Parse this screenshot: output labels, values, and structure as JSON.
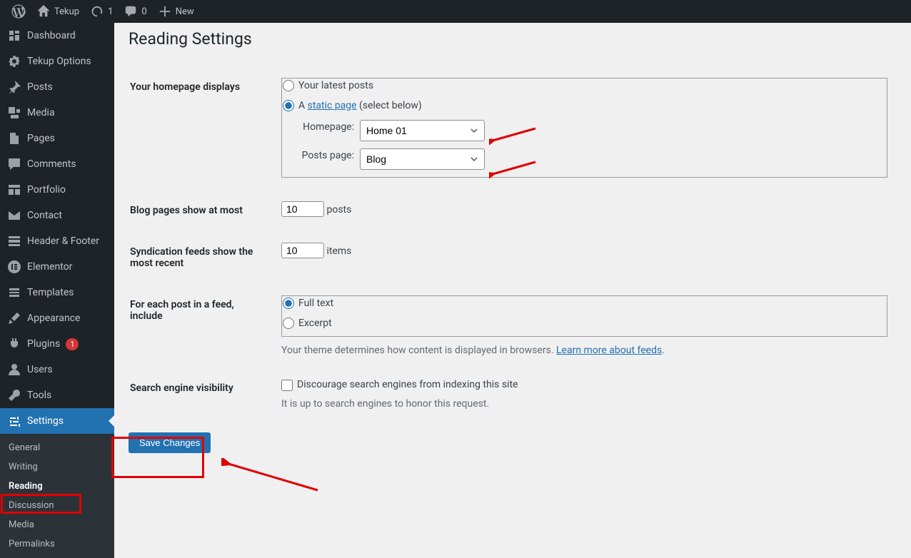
{
  "toolbar": {
    "site_name": "Tekup",
    "updates_count": "1",
    "comments_count": "0",
    "new_label": "New"
  },
  "sidebar": {
    "dashboard": "Dashboard",
    "tekup_options": "Tekup Options",
    "posts": "Posts",
    "media": "Media",
    "pages": "Pages",
    "comments": "Comments",
    "portfolio": "Portfolio",
    "contact": "Contact",
    "header_footer": "Header & Footer",
    "elementor": "Elementor",
    "templates": "Templates",
    "appearance": "Appearance",
    "plugins": "Plugins",
    "plugins_badge": "1",
    "users": "Users",
    "tools": "Tools",
    "settings": "Settings",
    "sub": {
      "general": "General",
      "writing": "Writing",
      "reading": "Reading",
      "discussion": "Discussion",
      "media": "Media",
      "permalinks": "Permalinks"
    }
  },
  "page": {
    "title": "Reading Settings",
    "homepage_displays_label": "Your homepage displays",
    "latest_posts_label": "Your latest posts",
    "static_page_prefix": "A ",
    "static_page_link": "static page",
    "static_page_suffix": " (select below)",
    "homepage_label": "Homepage:",
    "homepage_value": "Home 01",
    "posts_page_label": "Posts page:",
    "posts_page_value": "Blog",
    "blog_pages_label": "Blog pages show at most",
    "blog_pages_value": "10",
    "blog_pages_unit": "posts",
    "syndication_label": "Syndication feeds show the most recent",
    "syndication_value": "10",
    "syndication_unit": "items",
    "feed_include_label": "For each post in a feed, include",
    "feed_full_text": "Full text",
    "feed_excerpt": "Excerpt",
    "feed_desc_prefix": "Your theme determines how content is displayed in browsers. ",
    "feed_desc_link": "Learn more about feeds",
    "feed_desc_suffix": ".",
    "search_visibility_label": "Search engine visibility",
    "search_discourage": "Discourage search engines from indexing this site",
    "search_note": "It is up to search engines to honor this request.",
    "save_label": "Save Changes"
  }
}
